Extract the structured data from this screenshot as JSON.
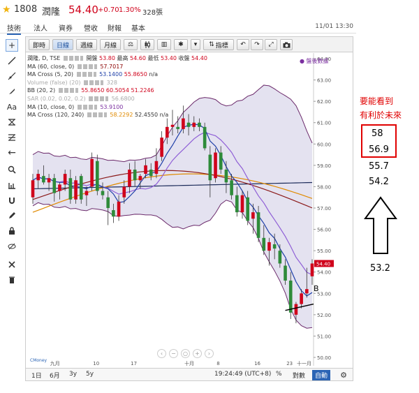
{
  "header": {
    "star_icon": "star-icon",
    "code": "1808",
    "name": "潤隆",
    "price": "54.40",
    "change": "+0.70",
    "percent": "1.30%",
    "volume": "328張"
  },
  "tabs": [
    {
      "label": "技術",
      "active": true
    },
    {
      "label": "法人"
    },
    {
      "label": "資券"
    },
    {
      "label": "營收"
    },
    {
      "label": "財報"
    },
    {
      "label": "基本"
    }
  ],
  "timestamp": "11/01 13:30",
  "toolbar": {
    "intraday": "即時",
    "daily": "日線",
    "weekly": "週線",
    "monthly": "月線",
    "indicators": "指標"
  },
  "legend": {
    "title": "潤隆, D, TSE",
    "open_label": "開盤",
    "open": "53.80",
    "high_label": "最高",
    "high": "54.60",
    "low_label": "最低",
    "low": "53.40",
    "close_label": "收盤",
    "close": "54.40",
    "ma60_label": "MA (60, close, 0)",
    "ma60": "57.7017",
    "macross5_label": "MA Cross (5, 20)",
    "macross5_a": "53.1400",
    "macross5_b": "55.8650",
    "macross5_c": "n/a",
    "volume_label": "Volume (false) (20)",
    "volume_val": "328",
    "bb_label": "BB (20, 2)",
    "bb_a": "55.8650",
    "bb_b": "60.5054",
    "bb_c": "51.2246",
    "sar_label": "SAR (0.02, 0.02, 0.2)",
    "sar": "56.6800",
    "ma10_label": "MA (10, close, 0)",
    "ma10": "53.9100",
    "macross120_label": "MA Cross (120, 240)",
    "macross120_a": "58.2292",
    "macross120_b": "52.4550",
    "macross120_c": "n/a",
    "after_hours": "盤後數據"
  },
  "bottom": {
    "d1": "1日",
    "m6": "6月",
    "y3": "3y",
    "y5": "5y",
    "clock": "19:24:49 (UTC+8)",
    "pct": "%",
    "log": "對數",
    "auto": "自動",
    "brand": "CMoney"
  },
  "chart_data": {
    "type": "candlestick",
    "y_axis_ticks": [
      "64.00",
      "63.00",
      "62.00",
      "61.00",
      "60.00",
      "59.00",
      "58.00",
      "57.00",
      "56.00",
      "55.00",
      "54.00",
      "53.00",
      "52.00",
      "51.00",
      "50.00"
    ],
    "x_axis_ticks": [
      "九月",
      "10",
      "17",
      "十月",
      "8",
      "16",
      "23",
      "十一月"
    ],
    "last_price_tag": "54.40",
    "annotation": "B",
    "candles": [
      [
        57.5,
        58.6,
        57.2,
        58.3
      ],
      [
        58.3,
        58.8,
        57.9,
        58.6
      ],
      [
        58.5,
        59.0,
        58.1,
        58.2
      ],
      [
        58.2,
        58.6,
        57.8,
        58.4
      ],
      [
        58.4,
        58.6,
        57.3,
        57.7
      ],
      [
        57.8,
        58.2,
        57.4,
        58.1
      ],
      [
        58.1,
        58.8,
        57.8,
        58.6
      ],
      [
        58.4,
        58.8,
        57.2,
        57.4
      ],
      [
        57.4,
        58.5,
        57.2,
        58.3
      ],
      [
        58.5,
        58.6,
        57.2,
        57.4
      ],
      [
        57.6,
        58.0,
        57.1,
        57.8
      ],
      [
        58.0,
        59.6,
        57.8,
        59.3
      ],
      [
        59.2,
        59.5,
        57.6,
        57.8
      ],
      [
        57.8,
        58.2,
        57.4,
        57.6
      ],
      [
        57.5,
        57.8,
        56.2,
        57.0
      ],
      [
        56.9,
        57.2,
        56.3,
        56.6
      ],
      [
        56.6,
        57.6,
        56.4,
        57.3
      ],
      [
        57.5,
        58.3,
        57.2,
        58.0
      ],
      [
        58.0,
        59.1,
        57.7,
        58.8
      ],
      [
        58.8,
        59.2,
        58.0,
        58.3
      ],
      [
        58.3,
        58.6,
        57.9,
        58.5
      ],
      [
        58.6,
        59.3,
        58.4,
        59.0
      ],
      [
        58.8,
        59.1,
        58.3,
        58.5
      ],
      [
        58.6,
        59.8,
        58.4,
        59.2
      ],
      [
        59.4,
        60.6,
        59.2,
        60.3
      ],
      [
        60.3,
        61.2,
        60.0,
        60.8
      ],
      [
        60.8,
        61.6,
        60.4,
        60.9
      ],
      [
        60.8,
        61.3,
        60.5,
        60.7
      ],
      [
        60.7,
        61.8,
        60.5,
        61.2
      ],
      [
        61.0,
        61.4,
        60.4,
        60.8
      ],
      [
        60.8,
        61.3,
        60.6,
        61.0
      ],
      [
        61.0,
        61.2,
        60.6,
        60.8
      ],
      [
        60.8,
        61.0,
        59.7,
        59.8
      ],
      [
        59.5,
        59.9,
        57.5,
        58.3
      ],
      [
        58.4,
        59.8,
        58.2,
        59.6
      ],
      [
        59.6,
        59.9,
        58.6,
        58.8
      ],
      [
        58.8,
        59.2,
        57.7,
        58.2
      ],
      [
        58.3,
        58.6,
        57.4,
        57.6
      ],
      [
        57.6,
        58.0,
        56.6,
        56.8
      ],
      [
        56.8,
        57.8,
        56.5,
        57.6
      ],
      [
        57.5,
        57.8,
        56.2,
        56.4
      ],
      [
        56.5,
        57.2,
        55.8,
        56.8
      ],
      [
        56.8,
        57.1,
        55.4,
        55.6
      ],
      [
        55.6,
        56.2,
        54.8,
        55.0
      ],
      [
        55.0,
        55.6,
        54.3,
        55.4
      ],
      [
        55.3,
        55.8,
        54.6,
        55.1
      ],
      [
        55.0,
        55.3,
        54.2,
        54.4
      ],
      [
        54.3,
        54.6,
        53.4,
        53.6
      ],
      [
        53.6,
        54.0,
        51.8,
        52.1
      ],
      [
        52.0,
        52.6,
        51.6,
        52.5
      ],
      [
        52.5,
        53.2,
        52.3,
        53.0
      ],
      [
        53.0,
        54.2,
        52.8,
        53.2
      ],
      [
        53.8,
        54.6,
        53.4,
        54.4
      ]
    ],
    "series": [
      {
        "name": "MA (10, close, 0)",
        "color": "#1e3fa8"
      },
      {
        "name": "MA Cross (5, 20)",
        "color": "#8f5fd6"
      },
      {
        "name": "MA (60, close, 0)",
        "color": "#8b1a1a"
      },
      {
        "name": "MA Cross (120, 240)",
        "color": "#e08a00"
      },
      {
        "name": "BB (20, 2)",
        "color": "#6b2a6b"
      }
    ]
  },
  "annotations": {
    "line1": "要能看到",
    "line2": "有利於未來",
    "v1": "58",
    "v2": "56.9",
    "v3": "55.7",
    "v4": "54.2",
    "v5": "53.2",
    "arrow_icon": "up-arrow-icon"
  }
}
